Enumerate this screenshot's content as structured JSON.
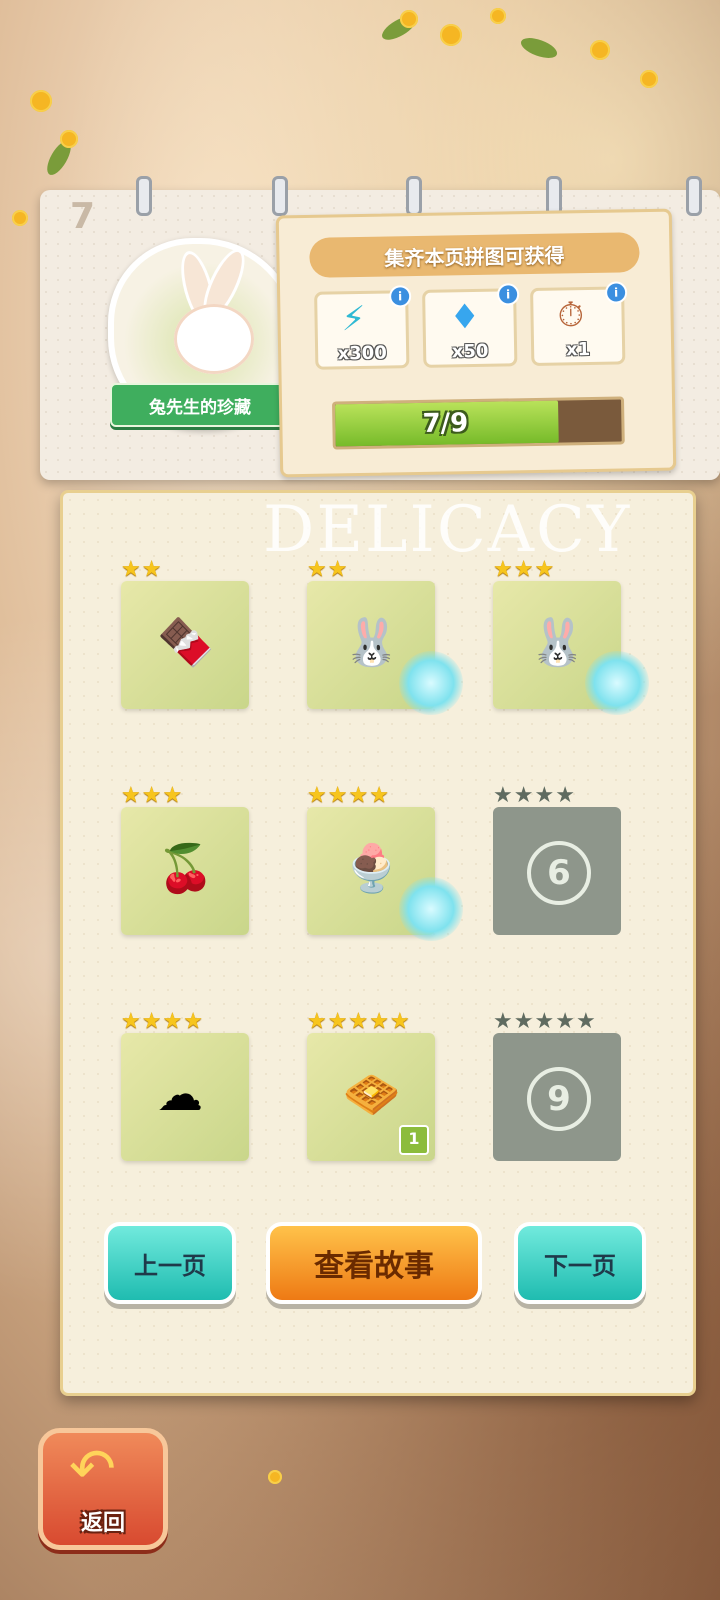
{
  "page_number": "7",
  "collection": {
    "title": "兔先生的珍藏"
  },
  "reward_panel": {
    "title": "集齐本页拼图可获得",
    "rewards": [
      {
        "icon": "energy-bolt-icon",
        "quantity": "x300"
      },
      {
        "icon": "diamond-icon",
        "quantity": "x50"
      },
      {
        "icon": "stopwatch-icon",
        "quantity": "x1"
      }
    ],
    "info_symbol": "i",
    "progress_text": "7/9",
    "progress_fraction": 0.778
  },
  "album": {
    "watermark": "DELICACY",
    "pieces": [
      {
        "index": 1,
        "stars": 2,
        "state": "collected"
      },
      {
        "index": 2,
        "stars": 2,
        "state": "collected"
      },
      {
        "index": 3,
        "stars": 3,
        "state": "collected"
      },
      {
        "index": 4,
        "stars": 3,
        "state": "collected"
      },
      {
        "index": 5,
        "stars": 4,
        "state": "collected"
      },
      {
        "index": 6,
        "stars": 4,
        "state": "locked",
        "label": "6"
      },
      {
        "index": 7,
        "stars": 4,
        "state": "collected"
      },
      {
        "index": 8,
        "stars": 5,
        "state": "collected",
        "badge": "1"
      },
      {
        "index": 9,
        "stars": 5,
        "state": "locked",
        "label": "9"
      }
    ]
  },
  "buttons": {
    "prev": "上一页",
    "story": "查看故事",
    "next": "下一页"
  },
  "back": {
    "label": "返回"
  },
  "colors": {
    "gold_star": "#f7c51d",
    "locked_piece": "#8e968b",
    "teal_button": "#1fbcb0",
    "orange_button": "#ee7a14"
  }
}
